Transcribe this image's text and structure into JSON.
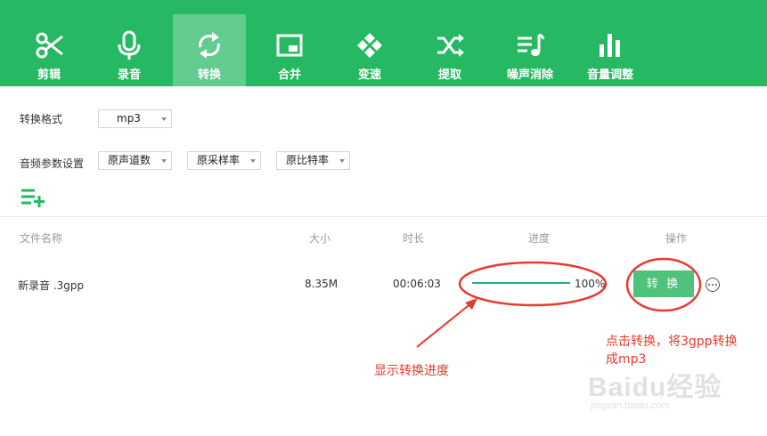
{
  "toolbar": {
    "tabs": [
      {
        "label": "剪辑",
        "icon": "scissors-icon"
      },
      {
        "label": "录音",
        "icon": "microphone-icon"
      },
      {
        "label": "转换",
        "icon": "convert-cycle-icon",
        "active": true
      },
      {
        "label": "合并",
        "icon": "merge-icon"
      },
      {
        "label": "变速",
        "icon": "speed-icon"
      },
      {
        "label": "提取",
        "icon": "shuffle-icon"
      },
      {
        "label": "噪声消除",
        "icon": "noise-removal-icon"
      },
      {
        "label": "音量调整",
        "icon": "volume-bars-icon"
      }
    ],
    "bg_color": "#27b863"
  },
  "settings": {
    "format_label": "转换格式",
    "format_value": "mp3",
    "audio_params_label": "音频参数设置",
    "channel_value": "原声道数",
    "sample_rate_value": "原采样率",
    "bitrate_value": "原比特率",
    "add_list_icon": "add-list-icon"
  },
  "table": {
    "headers": {
      "name": "文件名称",
      "size": "大小",
      "duration": "时长",
      "progress": "进度",
      "action": "操作"
    },
    "rows": [
      {
        "name": "新录音 .3gpp",
        "size": "8.35M",
        "duration": "00:06:03",
        "progress_text": "100%",
        "progress": 1.0,
        "action_label": "转 换"
      }
    ]
  },
  "annotations": {
    "progress_note": "显示转换进度",
    "convert_note_line1": "点击转换，将3gpp转换",
    "convert_note_line2": "成mp3",
    "color": "#e8392e"
  },
  "watermark": {
    "logo": "Baidu经验",
    "url": "jingyan.baidu.com"
  }
}
